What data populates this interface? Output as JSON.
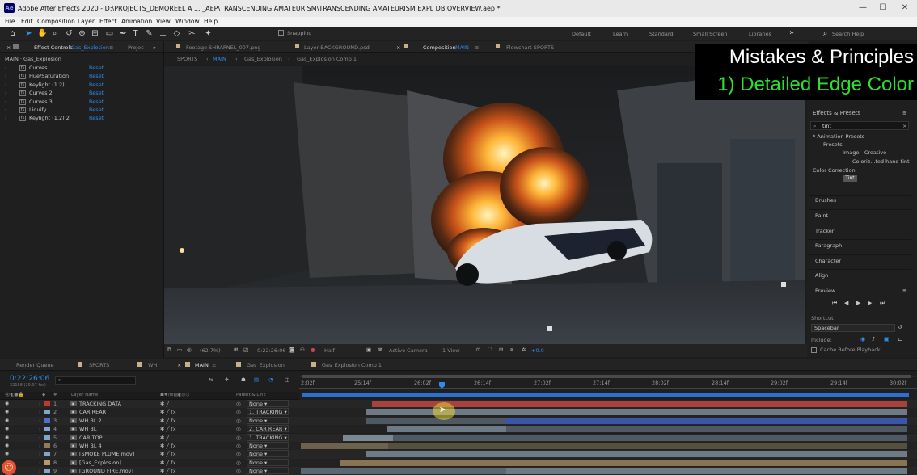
{
  "window": {
    "app_icon": "Ae",
    "title": "Adobe After Effects 2020 - D:\\PROJECTS_DEMOREEL A ... _AEP\\TRANSCENDING AMATEURISM\\TRANSCENDING AMATEURISM EXPL DB OVERVIEW.aep *",
    "controls": [
      "—",
      "☐",
      "✕"
    ]
  },
  "menu": [
    "File",
    "Edit",
    "Composition",
    "Layer",
    "Effect",
    "Animation",
    "View",
    "Window",
    "Help"
  ],
  "toolbar": {
    "snapping": "Snapping",
    "workspaces": [
      "Default",
      "Learn",
      "Standard",
      "Small Screen",
      "Libraries"
    ],
    "more": "»",
    "search_placeholder": "Search Help"
  },
  "effect_controls": {
    "tab": "Effect Controls",
    "tab_target": "Gas_Explosion",
    "tab2": "Projec",
    "breadcrumb": "MAIN · Gas_Explosion",
    "effects": [
      {
        "name": "Curves",
        "reset": "Reset"
      },
      {
        "name": "Hue/Saturation",
        "reset": "Reset"
      },
      {
        "name": "Keylight (1.2)",
        "reset": "Reset"
      },
      {
        "name": "Curves 2",
        "reset": "Reset"
      },
      {
        "name": "Curves 3",
        "reset": "Reset"
      },
      {
        "name": "Liquify",
        "reset": "Reset"
      },
      {
        "name": "Keylight (1.2) 2",
        "reset": "Reset"
      }
    ]
  },
  "viewer_tabs": {
    "footage": "Footage SHRAPNEL_007.png",
    "layer": "Layer BACKGROUND.psd",
    "composition_prefix": "Composition",
    "composition_name": "MAIN",
    "flowchart": "Flowchart SPORTS"
  },
  "comp_nav": [
    "SPORTS",
    "MAIN",
    "Gas_Explosion",
    "Gas_Explosion Comp 1"
  ],
  "overlay": {
    "line1": "Mistakes & Principles",
    "line2": "1) Detailed Edge Color"
  },
  "viewer_bar": {
    "zoom": "(62.7%)",
    "time": "0:22:26:06",
    "resolution": "Half",
    "camera": "Active Camera",
    "view": "1 View",
    "exposure": "+0.0"
  },
  "effects_presets": {
    "title": "Effects & Presets",
    "search": "tint",
    "tree": [
      "* Animation Presets",
      "Presets",
      "Image - Creative",
      "Coloriz...ted hand tint",
      "Color Correction",
      "Tint"
    ]
  },
  "right_panels": [
    "Brushes",
    "Paint",
    "Tracker",
    "Paragraph",
    "Character",
    "Align"
  ],
  "preview": {
    "title": "Preview",
    "shortcut_label": "Shortcut",
    "shortcut_value": "Spacebar",
    "include_label": "Include:",
    "cache_label": "Cache Before Playback"
  },
  "timeline_tabs": [
    "Render Queue",
    "SPORTS",
    "WH",
    "MAIN",
    "Gas_Explosion",
    "Gas_Explosion Comp 1"
  ],
  "timeline": {
    "current_time": "0:22:26:06",
    "fps_info": "32158 (29.97 fps)",
    "col_layer_name": "Layer Name",
    "col_parent": "Parent & Link",
    "ruler": [
      "2:02f",
      "25:14f",
      "26:02f",
      "26:14f",
      "27:02f",
      "27:14f",
      "28:02f",
      "28:14f",
      "29:02f",
      "29:14f",
      "30:02f"
    ],
    "layers": [
      {
        "num": "1",
        "name": "TRACKING DATA",
        "label_color": "#c0392b",
        "parent": "None",
        "fx": false
      },
      {
        "num": "2",
        "name": "CAR REAR",
        "label_color": "#7ea7c9",
        "parent": "1. TRACKING",
        "fx": true
      },
      {
        "num": "3",
        "name": "WH BL 2",
        "label_color": "#4a6fd0",
        "parent": "None",
        "fx": true
      },
      {
        "num": "4",
        "name": "WH BL",
        "label_color": "#7ea7c9",
        "parent": "2. CAR REAR",
        "fx": true
      },
      {
        "num": "5",
        "name": "CAR TOP",
        "label_color": "#7ea7c9",
        "parent": "1. TRACKING",
        "fx": false
      },
      {
        "num": "6",
        "name": "WH BL 4",
        "label_color": "#8f7a5a",
        "parent": "None",
        "fx": true
      },
      {
        "num": "7",
        "name": "[SMOKE PLUME.mov]",
        "label_color": "#7ea7c9",
        "parent": "None",
        "fx": true
      },
      {
        "num": "8",
        "name": "[Gas_Explosion]",
        "label_color": "#b89a6a",
        "parent": "None",
        "fx": true
      },
      {
        "num": "9",
        "name": "[GROUND FIRE.mov]",
        "label_color": "#7ea7c9",
        "parent": "None",
        "fx": true
      }
    ]
  }
}
